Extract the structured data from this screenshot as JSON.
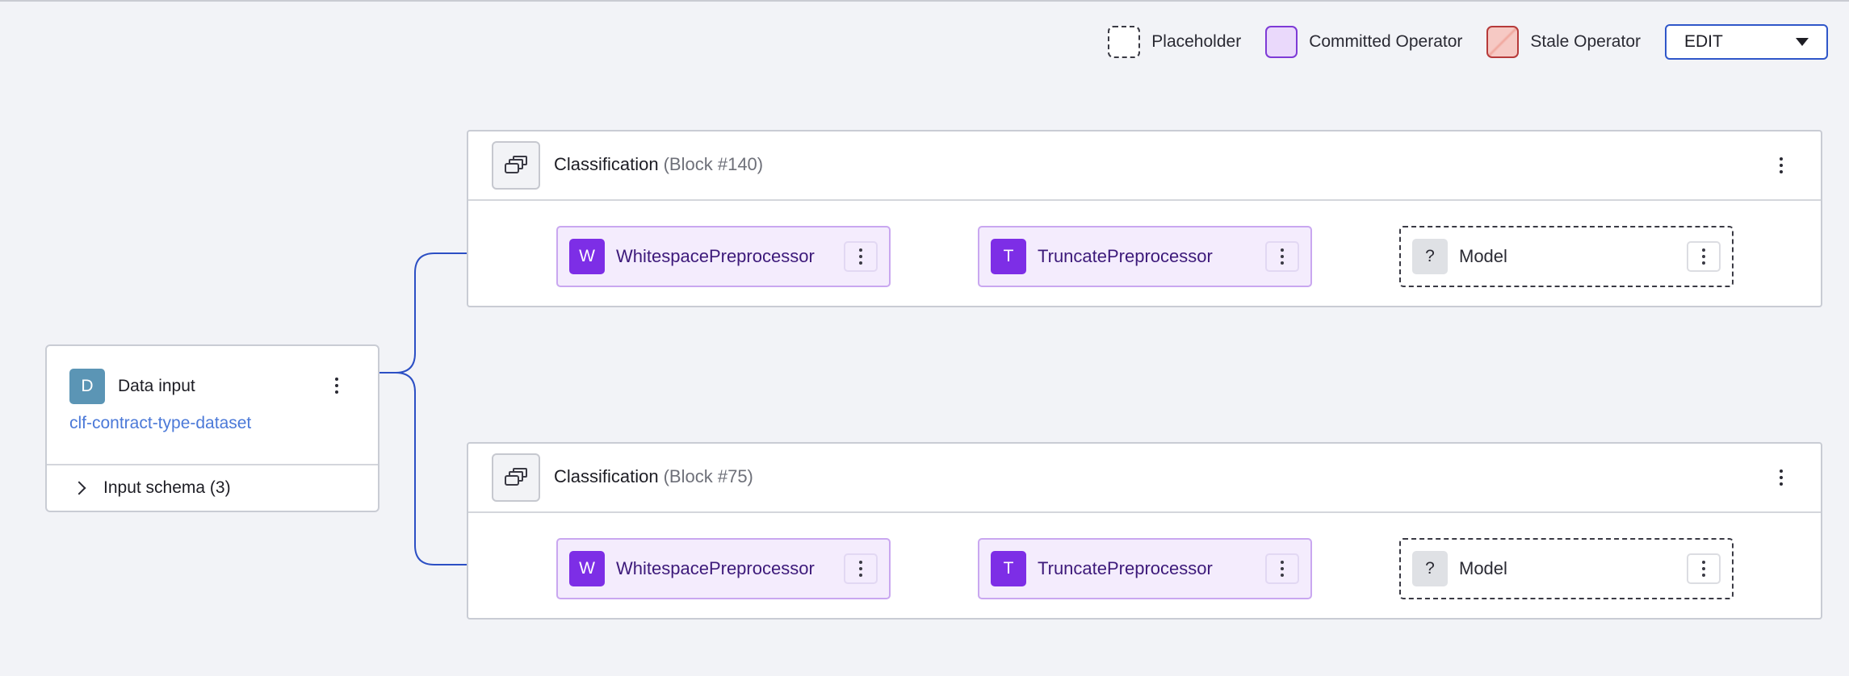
{
  "legend": {
    "placeholder_label": "Placeholder",
    "committed_label": "Committed Operator",
    "stale_label": "Stale Operator"
  },
  "mode_select": {
    "value": "EDIT"
  },
  "data_input": {
    "badge": "D",
    "title": "Data input",
    "dataset": "clf-contract-type-dataset",
    "schema_label": "Input schema (3)"
  },
  "blocks": [
    {
      "title": "Classification",
      "subtitle": "(Block #140)",
      "operators": [
        {
          "badge": "W",
          "label": "WhitespacePreprocessor",
          "state": "committed"
        },
        {
          "badge": "T",
          "label": "TruncatePreprocessor",
          "state": "committed"
        },
        {
          "badge": "?",
          "label": "Model",
          "state": "placeholder"
        }
      ]
    },
    {
      "title": "Classification",
      "subtitle": "(Block #75)",
      "operators": [
        {
          "badge": "W",
          "label": "WhitespacePreprocessor",
          "state": "committed"
        },
        {
          "badge": "T",
          "label": "TruncatePreprocessor",
          "state": "committed"
        },
        {
          "badge": "?",
          "label": "Model",
          "state": "placeholder"
        }
      ]
    }
  ],
  "colors": {
    "connector": "#2c4fc4",
    "committed_fill": "#f4ecfd",
    "operator_badge": "#7d2ee6",
    "data_badge": "#5b95b5",
    "link": "#4b79d8"
  }
}
